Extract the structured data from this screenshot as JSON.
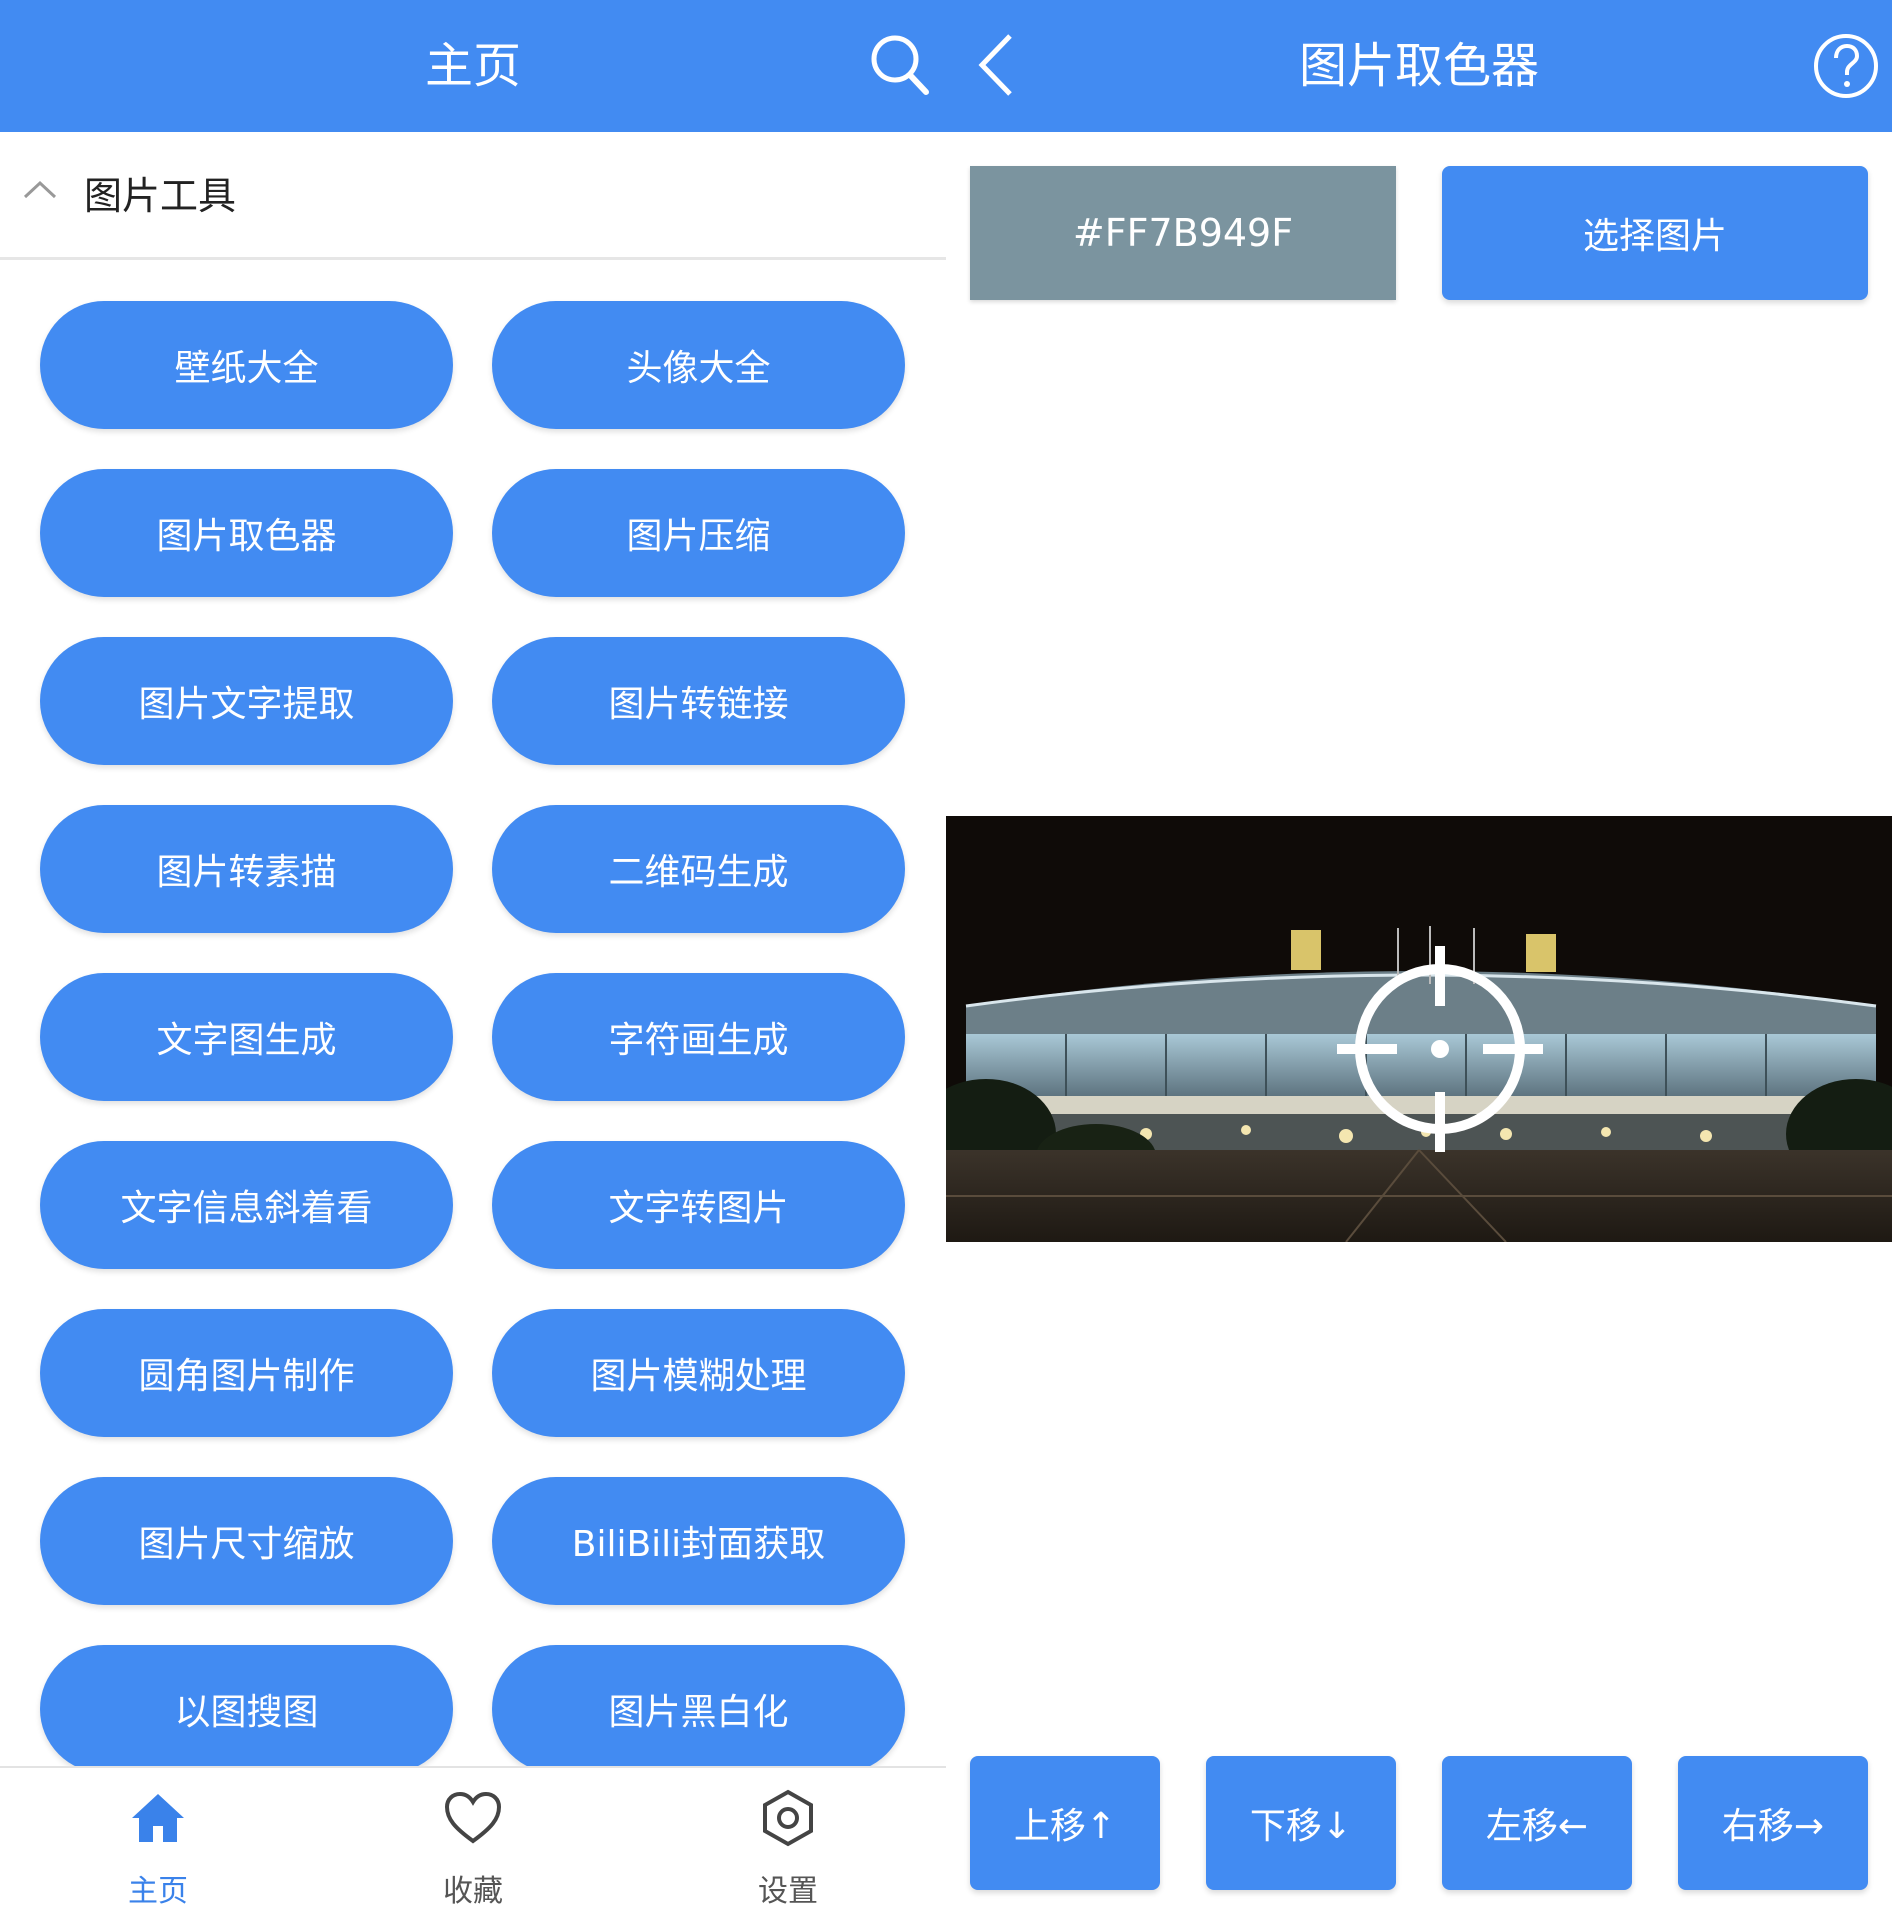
{
  "home": {
    "title": "主页",
    "section_title": "图片工具",
    "tools": [
      "壁纸大全",
      "头像大全",
      "图片取色器",
      "图片压缩",
      "图片文字提取",
      "图片转链接",
      "图片转素描",
      "二维码生成",
      "文字图生成",
      "字符画生成",
      "文字信息斜着看",
      "文字转图片",
      "圆角图片制作",
      "图片模糊处理",
      "图片尺寸缩放",
      "BiliBili封面获取",
      "以图搜图",
      "图片黑白化"
    ],
    "nav": [
      {
        "label": "主页",
        "icon": "home-icon",
        "active": true
      },
      {
        "label": "收藏",
        "icon": "heart-icon",
        "active": false
      },
      {
        "label": "设置",
        "icon": "settings-icon",
        "active": false
      }
    ]
  },
  "picker": {
    "title": "图片取色器",
    "color_value": "#FF7B949F",
    "select_label": "选择图片",
    "moves": [
      "上移↑",
      "下移↓",
      "左移←",
      "右移→"
    ]
  },
  "colors": {
    "accent": "#428bf2",
    "picked": "#7b949f",
    "text_dark": "#222222",
    "nav_inactive": "#555555"
  }
}
